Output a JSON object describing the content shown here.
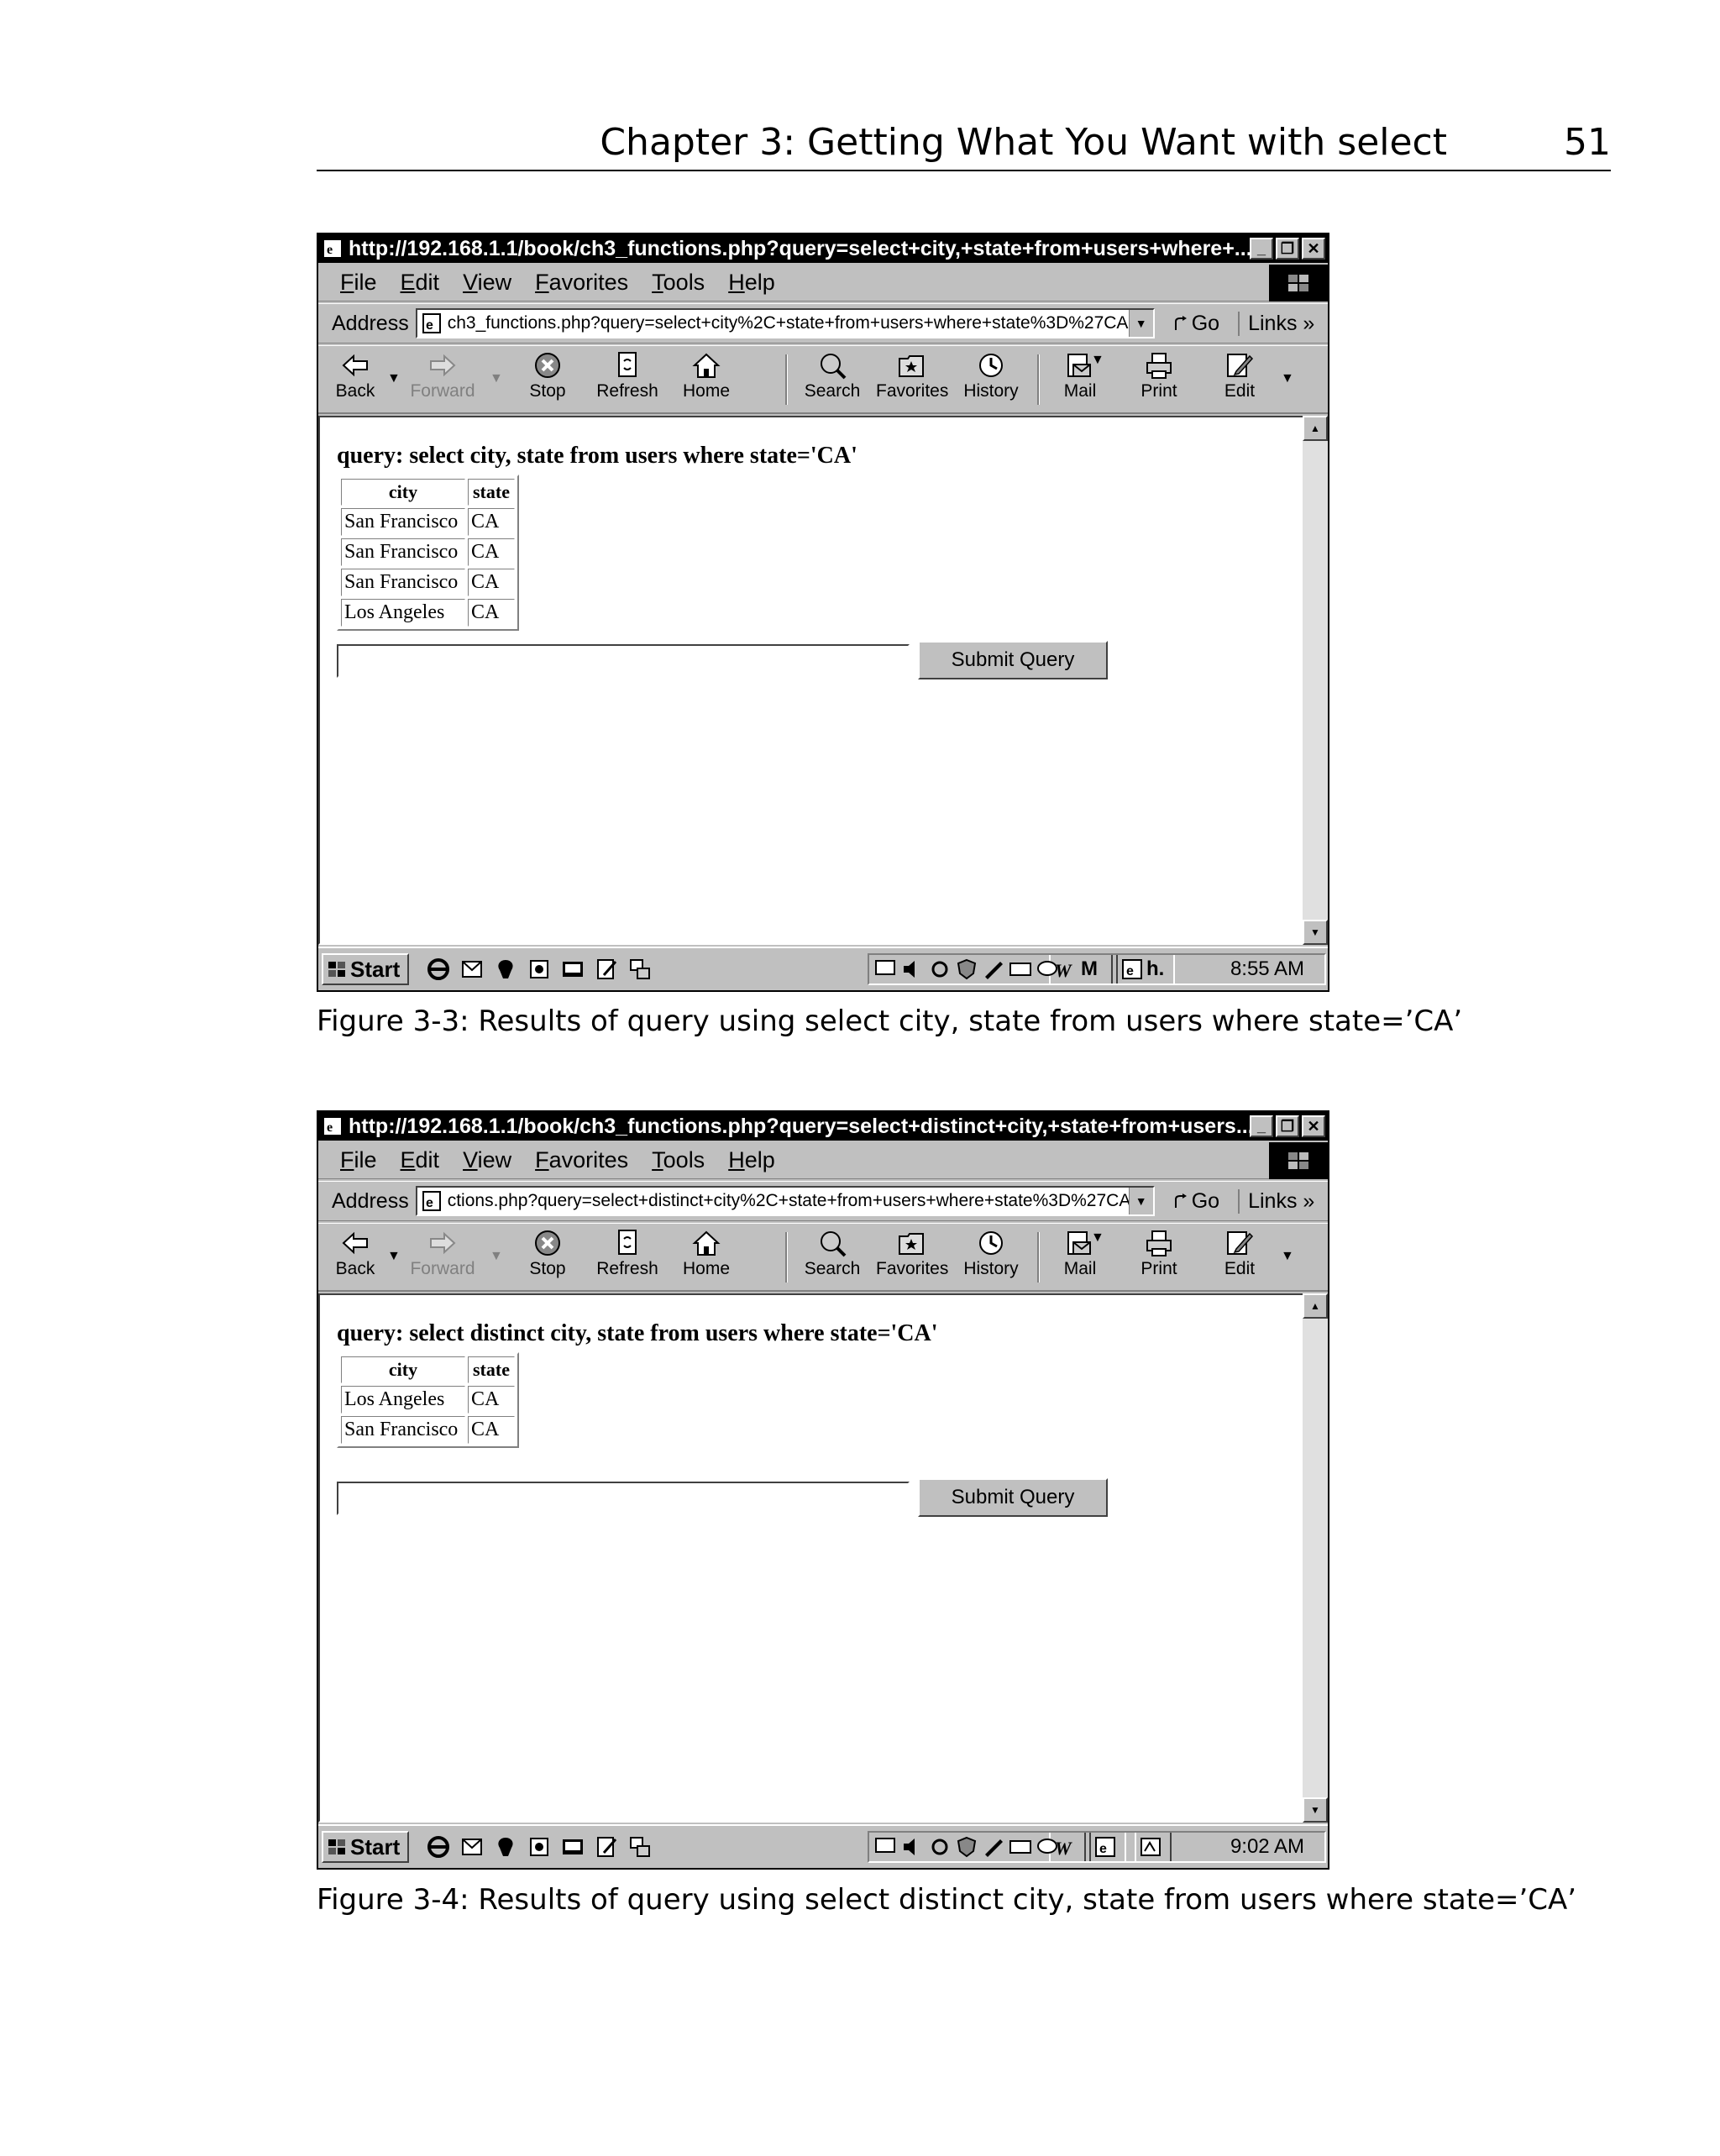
{
  "page_header": {
    "title": "Chapter 3: Getting What You Want with select",
    "page_number": "51"
  },
  "figures": [
    {
      "window_title": "http://192.168.1.1/book/ch3_functions.php?query=select+city,+state+from+users+where+...",
      "menu": [
        "File",
        "Edit",
        "View",
        "Favorites",
        "Tools",
        "Help"
      ],
      "address_label": "Address",
      "address_value": "ch3_functions.php?query=select+city%2C+state+from+users+where+state%3D%27CA%27",
      "go_label": "Go",
      "links_label": "Links",
      "toolbar": [
        "Back",
        "Forward",
        "Stop",
        "Refresh",
        "Home",
        "Search",
        "Favorites",
        "History",
        "Mail",
        "Print",
        "Edit"
      ],
      "query_heading": "query: select city, state from users where state='CA'",
      "columns": [
        "city",
        "state"
      ],
      "rows": [
        [
          "San Francisco",
          "CA"
        ],
        [
          "San Francisco",
          "CA"
        ],
        [
          "San Francisco",
          "CA"
        ],
        [
          "Los Angeles",
          "CA"
        ]
      ],
      "submit_label": "Submit Query",
      "start_label": "Start",
      "task_items": [
        "M",
        "h."
      ],
      "clock": "8:55 AM",
      "caption": "Figure 3-3: Results of query using select city, state from users where state=’CA’"
    },
    {
      "window_title": "http://192.168.1.1/book/ch3_functions.php?query=select+distinct+city,+state+from+users...",
      "menu": [
        "File",
        "Edit",
        "View",
        "Favorites",
        "Tools",
        "Help"
      ],
      "address_label": "Address",
      "address_value": "ctions.php?query=select+distinct+city%2C+state+from+users+where+state%3D%27CA%27",
      "go_label": "Go",
      "links_label": "Links",
      "toolbar": [
        "Back",
        "Forward",
        "Stop",
        "Refresh",
        "Home",
        "Search",
        "Favorites",
        "History",
        "Mail",
        "Print",
        "Edit"
      ],
      "query_heading": "query: select distinct city, state from users where state='CA'",
      "columns": [
        "city",
        "state"
      ],
      "rows": [
        [
          "Los Angeles",
          "CA"
        ],
        [
          "San Francisco",
          "CA"
        ]
      ],
      "submit_label": "Submit Query",
      "start_label": "Start",
      "task_items": [],
      "clock": "9:02 AM",
      "caption": "Figure 3-4: Results of query using select distinct city, state from users where state=’CA’"
    }
  ]
}
